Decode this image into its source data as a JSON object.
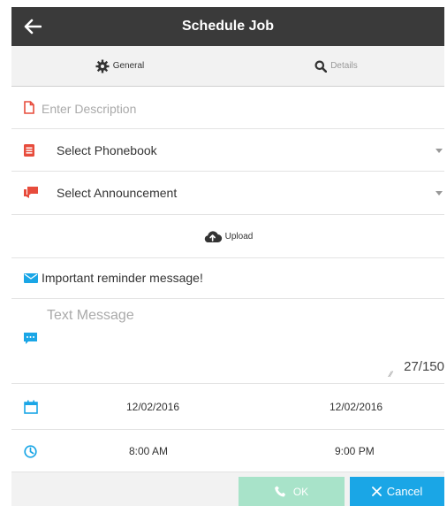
{
  "header": {
    "title": "Schedule Job"
  },
  "tabs": [
    {
      "label": "General",
      "active": true,
      "icon": "gear-icon"
    },
    {
      "label": "Details",
      "active": false,
      "icon": "search-icon"
    }
  ],
  "form": {
    "description_placeholder": "Enter Description",
    "phonebook_label": "Select Phonebook",
    "announcement_label": "Select Announcement",
    "upload_label": "Upload",
    "subject_value": "Important reminder message!",
    "message_placeholder": "Text Message",
    "char_counter": "27/150",
    "start_date": "12/02/2016",
    "end_date": "12/02/2016",
    "start_time": "8:00 AM",
    "end_time": "9:00 PM"
  },
  "footer": {
    "ok_label": "OK",
    "cancel_label": "Cancel"
  },
  "colors": {
    "header_bg": "#3a3a3a",
    "red_icon": "#e74c3c",
    "blue_icon": "#1aa6e6",
    "ok_bg": "#a8e3c9",
    "cancel_bg": "#1aa6e6"
  }
}
